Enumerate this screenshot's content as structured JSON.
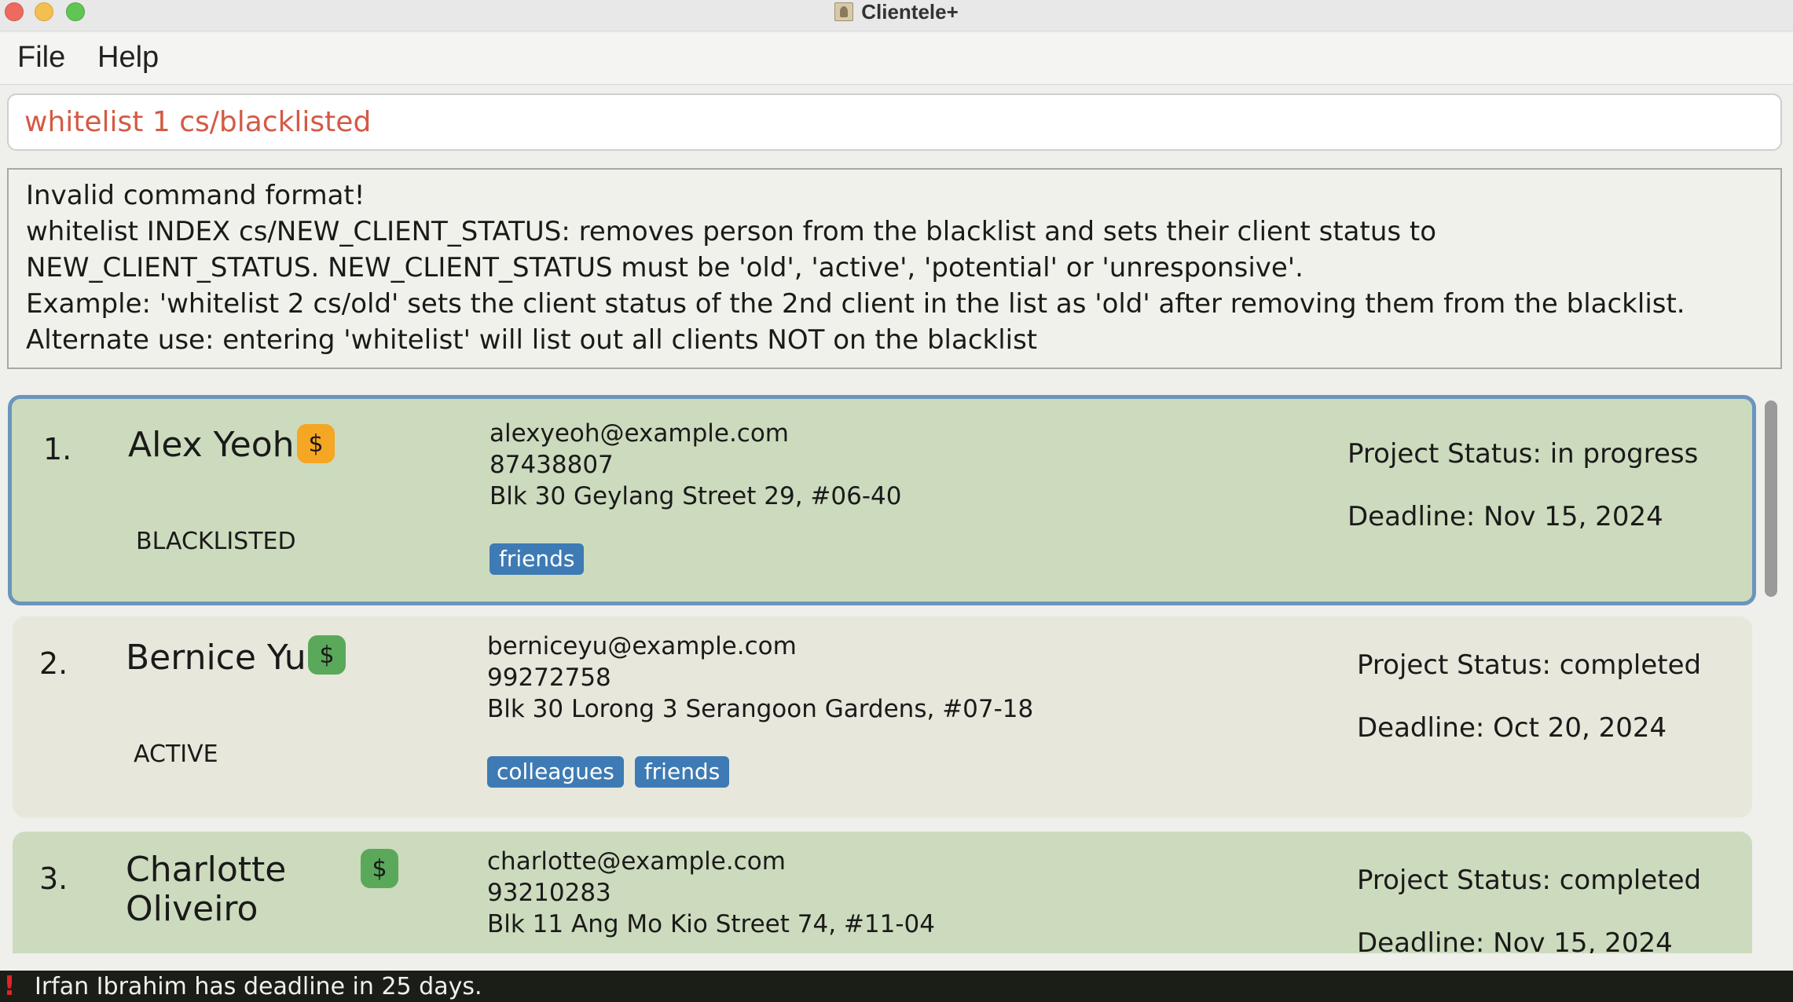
{
  "window": {
    "title": "Clientele+"
  },
  "menu": {
    "file": "File",
    "help": "Help"
  },
  "command": {
    "value": "whitelist 1 cs/blacklisted"
  },
  "result": {
    "lines": [
      "Invalid command format!",
      "whitelist INDEX cs/NEW_CLIENT_STATUS: removes person from the blacklist and sets their client status to",
      "NEW_CLIENT_STATUS. NEW_CLIENT_STATUS must be 'old', 'active', 'potential' or 'unresponsive'.",
      "Example: 'whitelist 2 cs/old' sets the client status of the 2nd client in the list as 'old' after removing them from the blacklist.",
      "Alternate use: entering 'whitelist' will list out all clients NOT on the blacklist"
    ]
  },
  "clients": [
    {
      "index": "1.",
      "name": "Alex Yeoh",
      "badge": "$",
      "badge_color": "#f5a623",
      "status": "BLACKLISTED",
      "email": "alexyeoh@example.com",
      "phone": "87438807",
      "address": "Blk 30 Geylang Street 29, #06-40",
      "tags": [
        "friends"
      ],
      "project_status": "Project Status: in progress",
      "deadline": "Deadline: Nov 15, 2024"
    },
    {
      "index": "2.",
      "name": "Bernice Yu",
      "badge": "$",
      "badge_color": "#5aa85a",
      "status": "ACTIVE",
      "email": "berniceyu@example.com",
      "phone": "99272758",
      "address": "Blk 30 Lorong 3 Serangoon Gardens, #07-18",
      "tags": [
        "colleagues",
        "friends"
      ],
      "project_status": "Project Status: completed",
      "deadline": "Deadline: Oct 20, 2024"
    },
    {
      "index": "3.",
      "name_line1": "Charlotte",
      "name_line2": "Oliveiro",
      "badge": "$",
      "badge_color": "#5aa85a",
      "email": "charlotte@example.com",
      "phone": "93210283",
      "address": "Blk 11 Ang Mo Kio Street 74, #11-04",
      "project_status": "Project Status: completed",
      "deadline": "Deadline: Nov 15, 2024"
    }
  ],
  "statusbar": {
    "icon": "exclamation-icon",
    "text": "Irfan Ibrahim has deadline in 25 days."
  }
}
